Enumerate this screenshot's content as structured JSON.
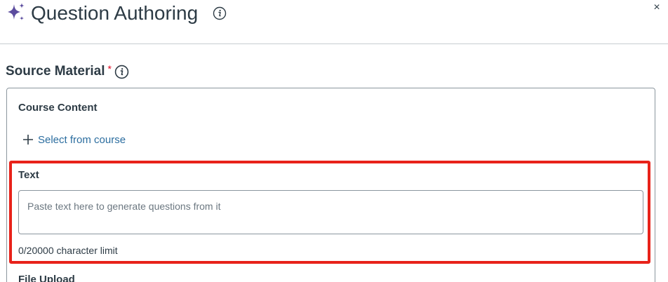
{
  "header": {
    "title": "Question Authoring",
    "close_label": "×",
    "icons": {
      "brand": "sparkle-icon",
      "info": "info-icon",
      "close": "close-icon"
    }
  },
  "source_material": {
    "title": "Source Material",
    "required_mark": "*",
    "course_content": {
      "label": "Course Content",
      "select_link": "Select from course"
    },
    "text": {
      "label": "Text",
      "value": "",
      "placeholder": "Paste text here to generate questions from it",
      "char_limit": "0/20000 character limit"
    },
    "file_upload": {
      "label": "File Upload"
    }
  },
  "colors": {
    "text": "#2d3b45",
    "link": "#2b6d9f",
    "required": "#e0061f",
    "highlight": "#e8221a",
    "sparkle": "#5b4c9e",
    "border": "#8b969e",
    "divider": "#c7cdd1"
  }
}
